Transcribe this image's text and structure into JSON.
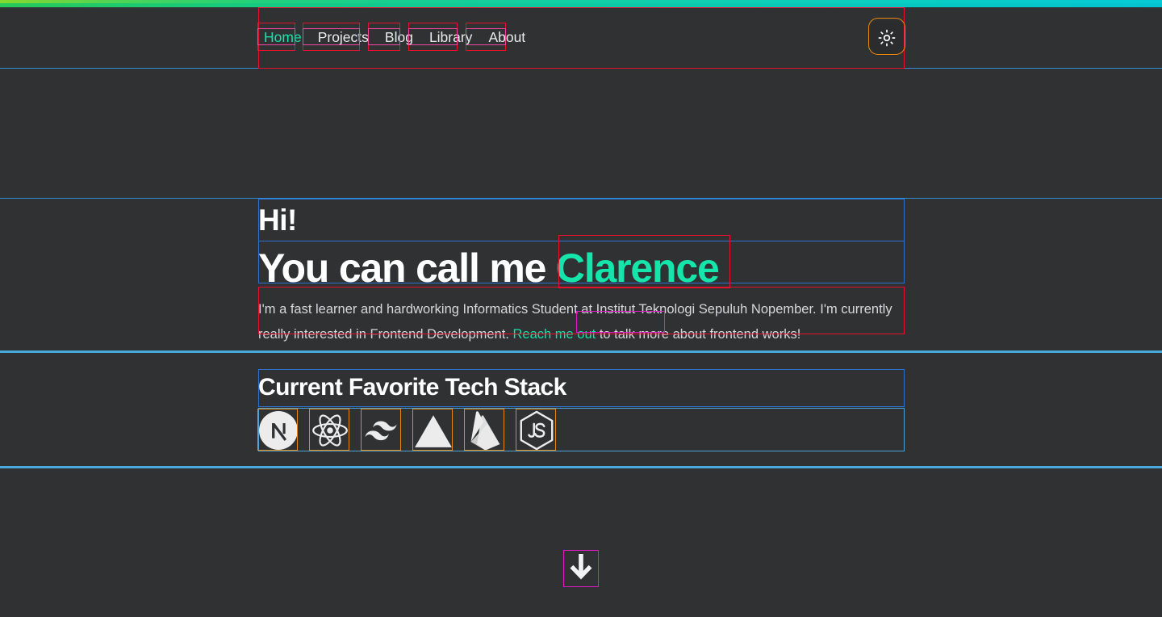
{
  "theme": {
    "background": "#2f3133",
    "accent": "#15e5ab",
    "text": "#ffffff",
    "muted_text": "#d6d8da",
    "gradient_start": "#86d92f",
    "gradient_end": "#06c9d6"
  },
  "navbar": {
    "links": [
      {
        "label": "Home",
        "active": true
      },
      {
        "label": "Projects",
        "active": false
      },
      {
        "label": "Blog",
        "active": false
      },
      {
        "label": "Library",
        "active": false
      },
      {
        "label": "About",
        "active": false
      }
    ],
    "theme_toggle": {
      "icon": "sun-icon",
      "label": "Toggle light mode"
    }
  },
  "hero": {
    "greeting": "Hi!",
    "intro_prefix": "You can call me ",
    "name": "Clarence",
    "description_part1": "I'm a fast learner and hardworking Informatics Student at Institut Teknologi Sepuluh Nopember. I'm currently really interested in Frontend Development. ",
    "description_link": "Reach me out",
    "description_part2": " to talk more about frontend works!"
  },
  "tech_stack": {
    "title": "Current Favorite Tech Stack",
    "items": [
      {
        "name": "Next.js",
        "icon": "nextjs-icon"
      },
      {
        "name": "React",
        "icon": "react-icon"
      },
      {
        "name": "Tailwind CSS",
        "icon": "tailwind-icon"
      },
      {
        "name": "Vercel",
        "icon": "vercel-icon"
      },
      {
        "name": "Firebase",
        "icon": "firebase-icon"
      },
      {
        "name": "Node.js",
        "icon": "nodejs-icon"
      }
    ]
  },
  "scroll_indicator": {
    "icon": "arrow-down-icon",
    "label": "Scroll down"
  }
}
